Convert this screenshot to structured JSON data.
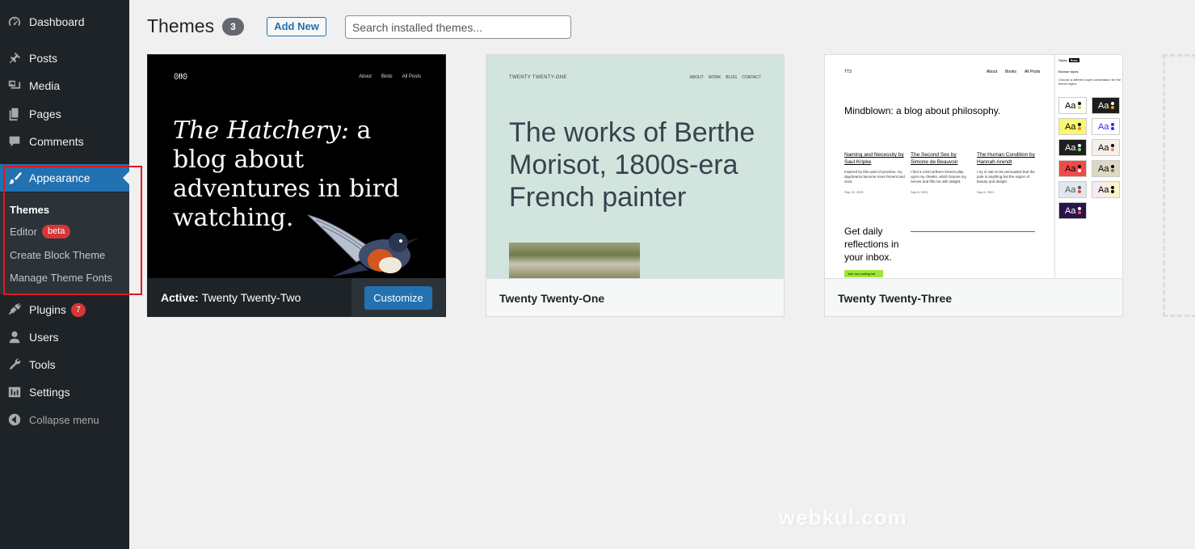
{
  "sidebar": {
    "items": [
      {
        "label": "Dashboard",
        "icon": "dashboard-icon"
      },
      {
        "label": "Posts",
        "icon": "pin-icon"
      },
      {
        "label": "Media",
        "icon": "media-icon"
      },
      {
        "label": "Pages",
        "icon": "pages-icon"
      },
      {
        "label": "Comments",
        "icon": "comment-icon"
      },
      {
        "label": "Appearance",
        "icon": "paintbrush-icon"
      },
      {
        "label": "Plugins",
        "icon": "plugin-icon",
        "badge": "7"
      },
      {
        "label": "Users",
        "icon": "user-icon"
      },
      {
        "label": "Tools",
        "icon": "wrench-icon"
      },
      {
        "label": "Settings",
        "icon": "settings-icon"
      }
    ],
    "appearance_submenu": [
      {
        "label": "Themes"
      },
      {
        "label": "Editor",
        "badge": "beta"
      },
      {
        "label": "Create Block Theme"
      },
      {
        "label": "Manage Theme Fonts"
      }
    ],
    "collapse_label": "Collapse menu"
  },
  "header": {
    "title": "Themes",
    "count": "3",
    "add_new_label": "Add New",
    "search_placeholder": "Search installed themes..."
  },
  "themes": [
    {
      "active_prefix": "Active:",
      "name": "Twenty Twenty-Two",
      "customize_label": "Customize",
      "preview": {
        "logo": "ᘛᘚ",
        "nav": [
          "About",
          "Birds",
          "All Posts"
        ],
        "title_italic": "The Hatchery:",
        "title_rest": " a blog about adventures in bird watching."
      }
    },
    {
      "name": "Twenty Twenty-One",
      "preview": {
        "brand": "TWENTY TWENTY-ONE",
        "nav": [
          "ABOUT",
          "WORK",
          "BLOG",
          "CONTACT"
        ],
        "title": "The works of Berthe Morisot, 1800s-era French painter"
      }
    },
    {
      "name": "Twenty Twenty-Three",
      "preview": {
        "logo": "TT3",
        "nav": [
          "About",
          "Books",
          "All Posts"
        ],
        "title": "Mindblown: a blog about philosophy.",
        "posts": [
          {
            "title": "Naming and Necessity by Saul Kripke",
            "excerpt": "Inspired by this wind of promise, my daydreams become more fervent and vivid.",
            "date": "Sep 10, 2021"
          },
          {
            "title": "The Second Sex by Simone de Beauvoir",
            "excerpt": "I feel a cold northern breeze play upon my cheeks, which braces my nerves and fills me with delight.",
            "date": "Sep 8, 2021"
          },
          {
            "title": "The Human Condition by Hannah Arendt",
            "excerpt": "I try in vain to be persuaded that the pole is anything but the region of beauty and delight.",
            "date": "Sep 6, 2021"
          }
        ],
        "cta": "Get daily reflections in your inbox.",
        "join_label": "Join our mailing list",
        "panel_title": "Styles",
        "panel_badge": "Beta",
        "panel_sub": "Browse styles",
        "panel_desc": "Choose a different style combination for the theme styles",
        "swatch_label": "Aa"
      }
    }
  ],
  "watermark": "webkul.com",
  "colors": {
    "sidebar_bg": "#1d2327",
    "accent": "#2271b1",
    "highlight": "#e3171f",
    "badge": "#d63638"
  }
}
